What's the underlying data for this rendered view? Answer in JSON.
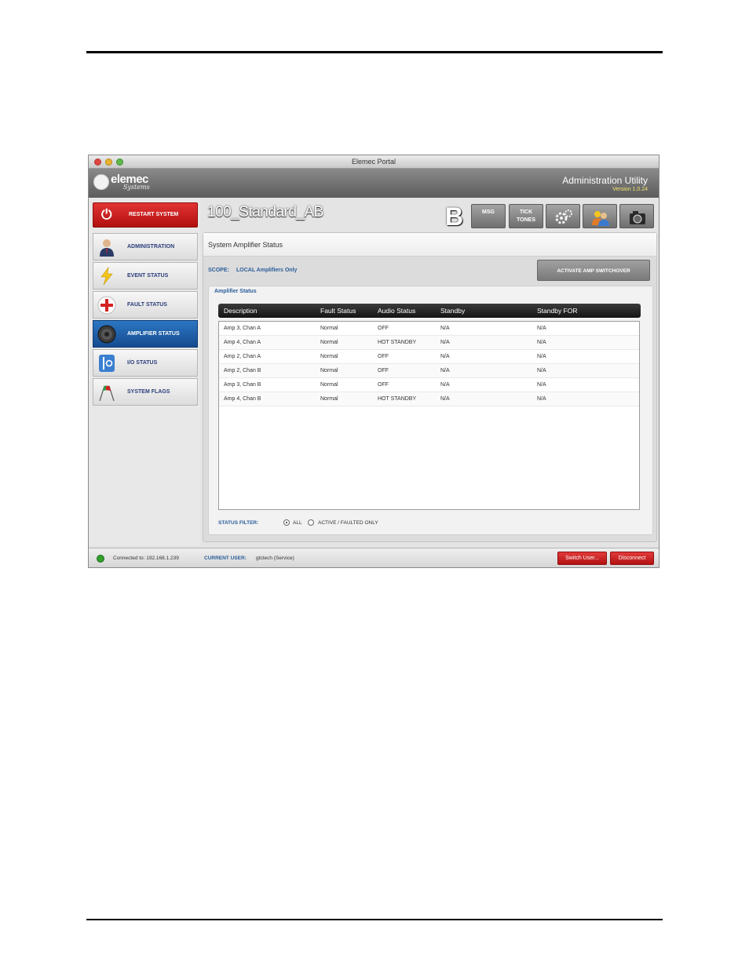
{
  "window": {
    "title": "Elemec Portal"
  },
  "header": {
    "logo_text": "elemec",
    "logo_sub": "Systems",
    "app_name": "Administration Utility",
    "version": "Version 1.0.24"
  },
  "sidebar": {
    "restart_label": "RESTART SYSTEM",
    "items": [
      {
        "label": "ADMINISTRATION",
        "icon": "user-admin-icon"
      },
      {
        "label": "EVENT STATUS",
        "icon": "lightning-icon"
      },
      {
        "label": "FAULT STATUS",
        "icon": "red-cross-icon"
      },
      {
        "label": "AMPLIFIER STATUS",
        "icon": "speaker-icon",
        "active": true
      },
      {
        "label": "I/O STATUS",
        "icon": "io-switch-icon"
      },
      {
        "label": "SYSTEM FLAGS",
        "icon": "flags-icon"
      }
    ]
  },
  "toolbar": {
    "system_name": "100_Standard_AB",
    "zone_letter": "B",
    "msg_label": "MSG",
    "tick_label_1": "TICK",
    "tick_label_2": "TONES"
  },
  "panel": {
    "title": "System Amplifier Status",
    "scope_label": "SCOPE:",
    "scope_value": "LOCAL Amplifiers Only",
    "switchover_label": "ACTIVATE AMP SWITCHOVER",
    "section_title": "Amplifier Status",
    "columns": [
      "Description",
      "Fault Status",
      "Audio Status",
      "Standby",
      "Standby FOR"
    ],
    "rows": [
      [
        "Amp 3, Chan A",
        "Normal",
        "OFF",
        "N/A",
        "N/A"
      ],
      [
        "Amp 4, Chan A",
        "Normal",
        "HOT STANDBY",
        "N/A",
        "N/A"
      ],
      [
        "Amp 2, Chan A",
        "Normal",
        "OFF",
        "N/A",
        "N/A"
      ],
      [
        "Amp 2, Chan B",
        "Normal",
        "OFF",
        "N/A",
        "N/A"
      ],
      [
        "Amp 3, Chan B",
        "Normal",
        "OFF",
        "N/A",
        "N/A"
      ],
      [
        "Amp 4, Chan B",
        "Normal",
        "HOT STANDBY",
        "N/A",
        "N/A"
      ]
    ],
    "filter_label": "STATUS FILTER:",
    "filter_options": [
      "ALL",
      "ACTIVE / FAULTED ONLY"
    ],
    "filter_selected": "ALL"
  },
  "statusbar": {
    "connected": "Connected to: 192.168.1.239",
    "current_user_label": "CURRENT USER:",
    "current_user": "gtctech  (Service)",
    "switch_user_label": "Switch User...",
    "disconnect_label": "Disconnect"
  },
  "colors": {
    "accent_blue": "#2b76c3",
    "danger_red": "#c41f1f",
    "label_blue": "#2a5d9a",
    "version_yellow": "#f2e36a"
  }
}
